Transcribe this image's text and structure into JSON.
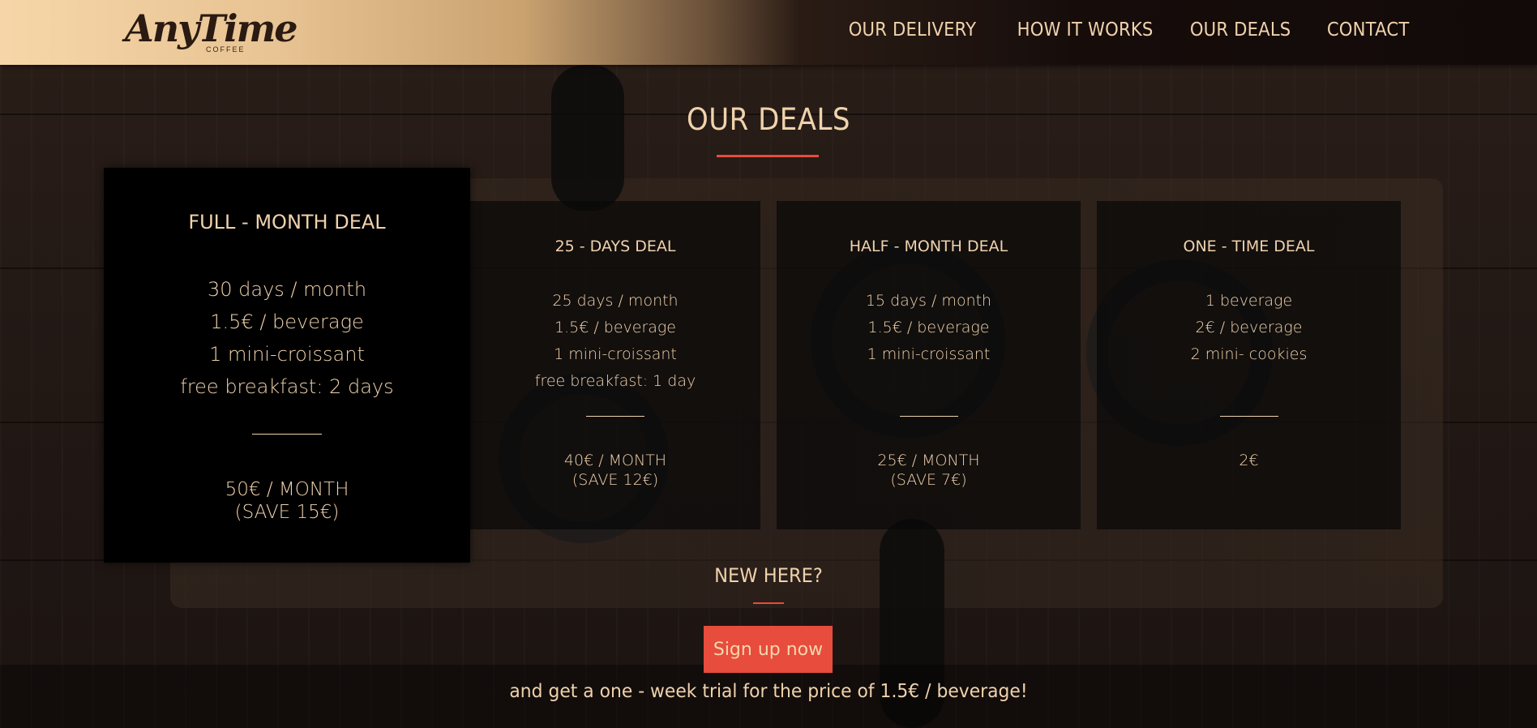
{
  "header": {
    "logo": {
      "script": "AnyTime",
      "sub": "COFFEE"
    },
    "nav": [
      {
        "label": "OUR DELIVERY"
      },
      {
        "label": "HOW IT WORKS"
      },
      {
        "label": "OUR DEALS"
      },
      {
        "label": "CONTACT"
      }
    ]
  },
  "section": {
    "title": "OUR DEALS"
  },
  "deals": [
    {
      "name": "FULL - MONTH DEAL",
      "features": [
        "30 days / month",
        "1.5€ / beverage",
        "1 mini-croissant",
        "free breakfast: 2 days"
      ],
      "price": "50€ / MONTH",
      "save": "(SAVE 15€)"
    },
    {
      "name": "25 - DAYS DEAL",
      "features": [
        "25 days / month",
        "1.5€ / beverage",
        "1 mini-croissant",
        "free breakfast: 1 day"
      ],
      "price": "40€ / MONTH",
      "save": "(SAVE 12€)"
    },
    {
      "name": "HALF - MONTH DEAL",
      "features": [
        "15 days / month",
        "1.5€ / beverage",
        "1 mini-croissant"
      ],
      "price": "25€ / MONTH",
      "save": "(SAVE 7€)"
    },
    {
      "name": "ONE - TIME DEAL",
      "features": [
        "1 beverage",
        "2€ / beverage",
        "2 mini- cookies"
      ],
      "price": "2€",
      "save": ""
    }
  ],
  "signup": {
    "heading": "NEW HERE?",
    "button": "Sign up now",
    "tagline": "and get a one - week trial for the price of 1.5€ / beverage!"
  },
  "colors": {
    "accent": "#e74c3c",
    "text": "#f0d2ac",
    "card_featured": "#000000",
    "card": "#0a0a0a"
  }
}
